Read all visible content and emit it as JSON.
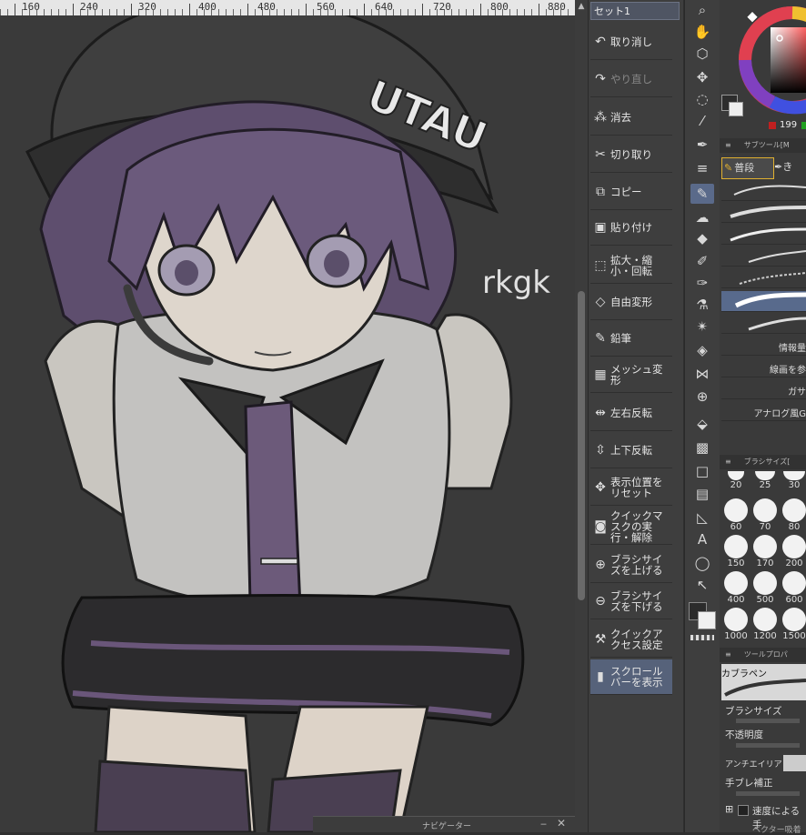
{
  "ruler": {
    "labels": [
      "160",
      "240",
      "320",
      "400",
      "480",
      "560",
      "640",
      "720",
      "800",
      "880"
    ]
  },
  "artwork": {
    "cap_text": "UTAU",
    "scribble_text": "rkgk"
  },
  "navigator": {
    "title": "ナビゲーター"
  },
  "command_bar": {
    "set_name": "セット1",
    "items": [
      {
        "label": "取り消し",
        "icon": "undo-icon"
      },
      {
        "label": "やり直し",
        "icon": "redo-icon"
      },
      {
        "label": "消去",
        "icon": "clear-icon"
      },
      {
        "label": "切り取り",
        "icon": "scissors-icon"
      },
      {
        "label": "コピー",
        "icon": "copy-icon"
      },
      {
        "label": "貼り付け",
        "icon": "paste-icon"
      },
      {
        "label": "拡大・縮小・回転",
        "icon": "scale-rotate-icon"
      },
      {
        "label": "自由変形",
        "icon": "free-transform-icon"
      },
      {
        "label": "鉛筆",
        "icon": "pencil-icon"
      },
      {
        "label": "メッシュ変形",
        "icon": "mesh-transform-icon"
      },
      {
        "label": "左右反転",
        "icon": "flip-horizontal-icon"
      },
      {
        "label": "上下反転",
        "icon": "flip-vertical-icon"
      },
      {
        "label": "表示位置をリセット",
        "icon": "reset-view-icon"
      },
      {
        "label": "クイックマスクの実行・解除",
        "icon": "quick-mask-icon"
      },
      {
        "label": "ブラシサイズを上げる",
        "icon": "brush-size-up-icon"
      },
      {
        "label": "ブラシサイズを下げる",
        "icon": "brush-size-down-icon"
      },
      {
        "label": "クイックアクセス設定",
        "icon": "wrench-icon"
      },
      {
        "label": "スクロールバーを表示",
        "icon": "scrollbar-icon"
      }
    ]
  },
  "color": {
    "r_value": "199",
    "hue_marker": "#e05030"
  },
  "sub_tool": {
    "title": "サブツール[M",
    "tab_normal": "普段",
    "tab_other": "き",
    "brushes": [
      "",
      "",
      "",
      "",
      "",
      "",
      "情報量",
      "線画を参",
      "ガサ",
      "アナログ風G",
      ""
    ]
  },
  "brush_size": {
    "title": "ブラシサイズ[",
    "sizes": [
      "20",
      "25",
      "30",
      "60",
      "70",
      "80",
      "150",
      "170",
      "200",
      "400",
      "500",
      "600",
      "1000",
      "1200",
      "1500"
    ]
  },
  "tool_property": {
    "title": "ツールプロパ",
    "tool_name": "カブラペン",
    "rows": [
      "ブラシサイズ",
      "不透明度",
      "アンチエイリア",
      "手ブレ補正",
      "速度による手"
    ],
    "footer": "ベクター吸着"
  }
}
